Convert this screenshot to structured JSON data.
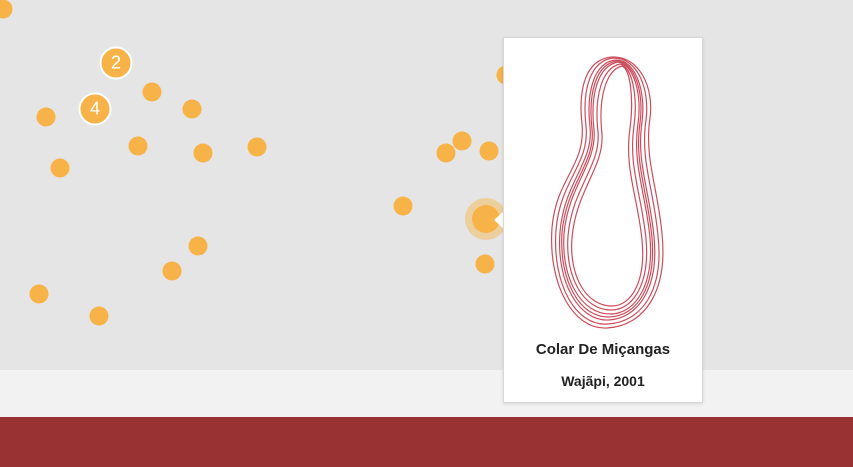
{
  "map": {
    "marker_color": "#f7b347",
    "clusters": [
      {
        "count": "2"
      },
      {
        "count": "4"
      }
    ]
  },
  "popup": {
    "image_icon": "beaded-necklace-icon",
    "title": "Colar De Miçangas",
    "subtitle": "Wajãpi, 2001"
  },
  "footer": {
    "color": "#993333"
  }
}
